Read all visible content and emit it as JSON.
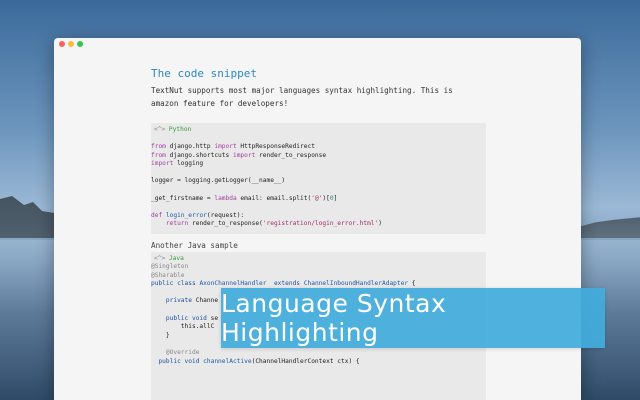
{
  "article": {
    "heading": "The code snippet",
    "intro": "TextNut supports most major languages syntax highlighting. This is amazon feature for developers!",
    "second_section_label": "Another Java sample"
  },
  "python_block": {
    "brace": "<^>",
    "language": "Python",
    "lines": [
      [
        {
          "t": "from",
          "c": "kw"
        },
        {
          "t": " django.http ",
          "c": ""
        },
        {
          "t": "import",
          "c": "kw"
        },
        {
          "t": " HttpResponseRedirect",
          "c": ""
        }
      ],
      [
        {
          "t": "from",
          "c": "kw"
        },
        {
          "t": " django.shortcuts ",
          "c": ""
        },
        {
          "t": "import",
          "c": "kw"
        },
        {
          "t": " render_to_response",
          "c": ""
        }
      ],
      [
        {
          "t": "import",
          "c": "kw"
        },
        {
          "t": " logging",
          "c": ""
        }
      ],
      [],
      [
        {
          "t": "logger = logging.getLogger(__name__)",
          "c": ""
        }
      ],
      [],
      [
        {
          "t": "_get_firstname = ",
          "c": ""
        },
        {
          "t": "lambda",
          "c": "kw"
        },
        {
          "t": " email: email.split(",
          "c": ""
        },
        {
          "t": "'@'",
          "c": "str"
        },
        {
          "t": ")[",
          "c": ""
        },
        {
          "t": "0",
          "c": "num"
        },
        {
          "t": "]",
          "c": ""
        }
      ],
      [],
      [
        {
          "t": "def",
          "c": "kw"
        },
        {
          "t": " ",
          "c": ""
        },
        {
          "t": "login_error",
          "c": "fn"
        },
        {
          "t": "(request):",
          "c": ""
        }
      ],
      [
        {
          "t": "    ",
          "c": ""
        },
        {
          "t": "return",
          "c": "kw"
        },
        {
          "t": " render_to_response(",
          "c": ""
        },
        {
          "t": "'registration/login_error.html'",
          "c": "str"
        },
        {
          "t": ")",
          "c": ""
        }
      ]
    ]
  },
  "java_block": {
    "brace": "<^>",
    "language": "Java",
    "lines": [
      [
        {
          "t": "@Singleton",
          "c": "ann"
        }
      ],
      [
        {
          "t": "@Sharable",
          "c": "ann"
        }
      ],
      [
        {
          "t": "public class",
          "c": "kw2"
        },
        {
          "t": " ",
          "c": ""
        },
        {
          "t": "AxonChannelHandler",
          "c": "fn"
        },
        {
          "t": "  extends ",
          "c": "kw2"
        },
        {
          "t": "ChannelInboundHandlerAdapter",
          "c": "fn"
        },
        {
          "t": " {",
          "c": ""
        }
      ],
      [],
      [
        {
          "t": "    private ",
          "c": "kw2"
        },
        {
          "t": "Channe",
          "c": ""
        }
      ],
      [],
      [
        {
          "t": "    public void ",
          "c": "kw2"
        },
        {
          "t": "se",
          "c": ""
        }
      ],
      [
        {
          "t": "        this.allC",
          "c": ""
        }
      ],
      [
        {
          "t": "    }",
          "c": ""
        }
      ],
      [],
      [
        {
          "t": "    @Override",
          "c": "ann"
        }
      ],
      [
        {
          "t": "  public void ",
          "c": "kw2"
        },
        {
          "t": "channelActive",
          "c": "fn"
        },
        {
          "t": "(ChannelHandlerContext ctx) {",
          "c": ""
        }
      ]
    ]
  },
  "banner": {
    "text": "Language Syntax Highlighting"
  }
}
